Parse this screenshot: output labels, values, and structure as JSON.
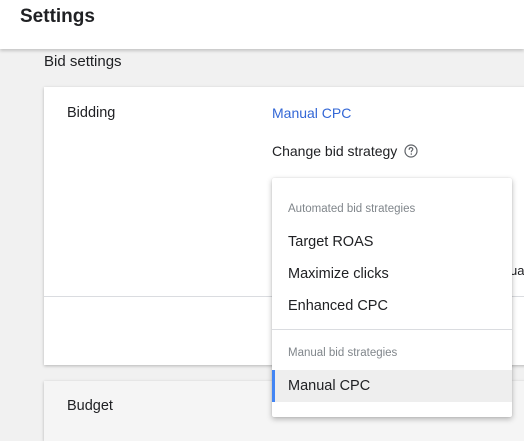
{
  "header": {
    "title": "Settings"
  },
  "section": {
    "title": "Bid settings"
  },
  "bidding": {
    "label": "Bidding",
    "current_strategy": "Manual CPC",
    "change_label": "Change bid strategy",
    "partial_text": "ual"
  },
  "budget": {
    "label": "Budget"
  },
  "dropdown": {
    "automated_header": "Automated bid strategies",
    "automated_items": [
      "Target ROAS",
      "Maximize clicks",
      "Enhanced CPC"
    ],
    "manual_header": "Manual bid strategies",
    "manual_items": [
      "Manual CPC"
    ],
    "selected": "Manual CPC"
  },
  "icons": {
    "help": "help-circle-icon"
  },
  "colors": {
    "link": "#3367d6",
    "selected_accent": "#4285f4",
    "selected_bg": "#eeeeee"
  }
}
